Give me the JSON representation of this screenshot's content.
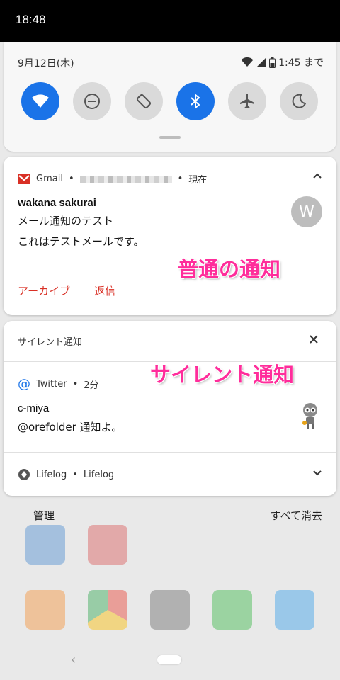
{
  "status_bar": {
    "time": "18:48"
  },
  "quick_settings": {
    "date": "9月12日(木)",
    "battery_text": "1:45 まで",
    "tiles": [
      {
        "name": "wifi",
        "active": true
      },
      {
        "name": "do-not-disturb",
        "active": false
      },
      {
        "name": "auto-rotate",
        "active": false
      },
      {
        "name": "bluetooth",
        "active": true
      },
      {
        "name": "airplane-mode",
        "active": false
      },
      {
        "name": "night-light",
        "active": false
      }
    ]
  },
  "gmail_notification": {
    "app": "Gmail",
    "time": "現在",
    "sender": "wakana sakurai",
    "subject": "メール通知のテスト",
    "body": "これはテストメールです。",
    "avatar_letter": "W",
    "action_archive": "アーカイブ",
    "action_reply": "返信",
    "overlay_label": "普通の通知",
    "accent_color": "#d93025"
  },
  "silent_section": {
    "title": "サイレント通知",
    "overlay_label": "サイレント通知",
    "twitter": {
      "app": "Twitter",
      "time": "2分",
      "sender": "c-miya",
      "body": "@orefolder 通知よ。"
    },
    "lifelog": {
      "app": "Lifelog",
      "title": "Lifelog"
    }
  },
  "footer": {
    "manage": "管理",
    "clear_all": "すべて消去"
  },
  "colors": {
    "tile_active": "#1a73e8",
    "tile_inactive": "#dadada",
    "overlay_pink": "#ff2d9b"
  }
}
